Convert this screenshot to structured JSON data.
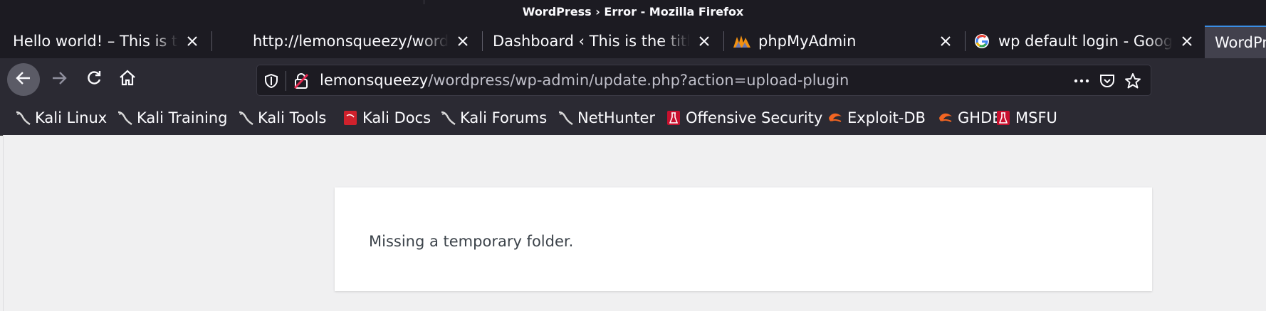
{
  "window": {
    "title": "WordPress › Error - Mozilla Firefox"
  },
  "tabs": [
    {
      "label": "Hello world! – This is the title of the site",
      "favicon": "none",
      "active": false
    },
    {
      "label": "http://lemonsqueezy/wordpress/wp-admin",
      "favicon": "none",
      "active": false
    },
    {
      "label": "Dashboard ‹ This is the title of the site",
      "favicon": "none",
      "active": false
    },
    {
      "label": "phpMyAdmin",
      "favicon": "phpmyadmin-logo-icon",
      "active": false
    },
    {
      "label": "wp default login - Google Search",
      "favicon": "google-logo-icon",
      "active": false
    },
    {
      "label": "WordPress › Error",
      "favicon": "none",
      "active": true
    }
  ],
  "navbar": {
    "url_host": "lemonsqueezy",
    "url_path": "/wordpress/wp-admin/update.php?action=upload-plugin"
  },
  "bookmarks": [
    {
      "label": "Kali Linux",
      "icon": "kali-dragon-icon"
    },
    {
      "label": "Kali Training",
      "icon": "kali-dragon-icon"
    },
    {
      "label": "Kali Tools",
      "icon": "kali-dragon-icon"
    },
    {
      "label": "Kali Docs",
      "icon": "kali-docs-icon"
    },
    {
      "label": "Kali Forums",
      "icon": "kali-dragon-icon"
    },
    {
      "label": "NetHunter",
      "icon": "kali-dragon-icon"
    },
    {
      "label": "Offensive Security",
      "icon": "offsec-icon"
    },
    {
      "label": "Exploit-DB",
      "icon": "exploitdb-icon"
    },
    {
      "label": "GHDB",
      "icon": "exploitdb-icon"
    },
    {
      "label": "MSFU",
      "icon": "offsec-icon"
    }
  ],
  "page": {
    "error_message": "Missing a temporary folder."
  },
  "colors": {
    "tab_accent": "#3a8ee6",
    "chrome_dark": "#1c1b22",
    "toolbar": "#2b2a33",
    "page_bg": "#f0f0f1",
    "card_bg": "#ffffff"
  }
}
